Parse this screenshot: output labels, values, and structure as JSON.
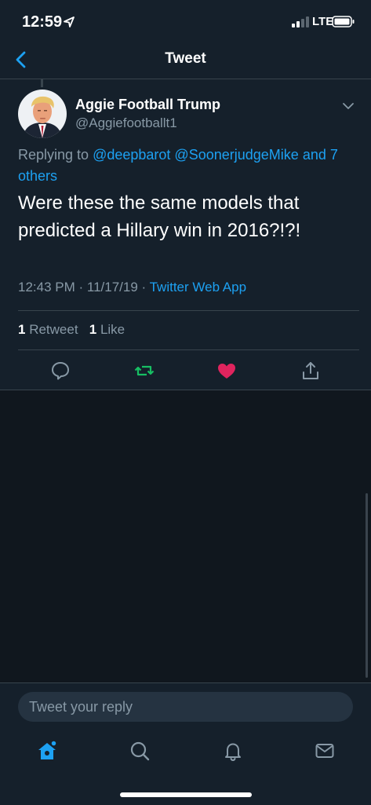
{
  "status_bar": {
    "time": "12:59",
    "network": "LTE"
  },
  "header": {
    "title": "Tweet"
  },
  "tweet": {
    "display_name": "Aggie Football Trump",
    "handle": "@Aggiefootballt1",
    "replying_prefix": "Replying to ",
    "mention_1": "@deepbarot",
    "mention_2": "@SoonerjudgeMike",
    "others": "and 7 others",
    "text": "Were these the same models that predicted a Hillary win in 2016?!?!",
    "timestamp": "12:43 PM · 11/17/19 · ",
    "source": "Twitter Web App",
    "retweet_count": "1",
    "retweet_label": "Retweet",
    "like_count": "1",
    "like_label": "Like",
    "liked": true
  },
  "reply_box": {
    "placeholder": "Tweet your reply"
  },
  "colors": {
    "accent": "#1da1f2",
    "retweet": "#17bf63",
    "like": "#e0245e",
    "background": "#15202b"
  },
  "icons": {
    "back": "back-arrow-icon",
    "more": "chevron-down-icon",
    "reply": "reply-icon",
    "retweet": "retweet-icon",
    "like": "heart-icon",
    "share": "share-icon",
    "tab_home": "home-icon",
    "tab_search": "search-icon",
    "tab_notifications": "bell-icon",
    "tab_messages": "mail-icon"
  }
}
